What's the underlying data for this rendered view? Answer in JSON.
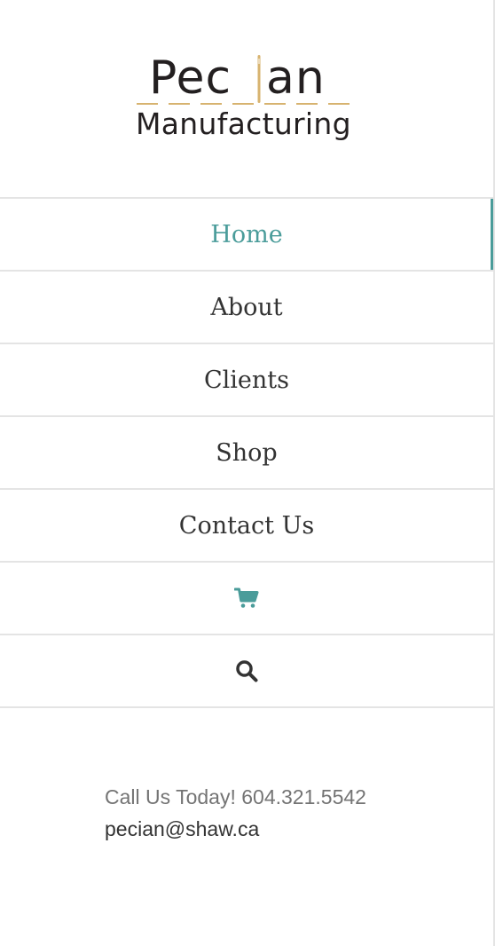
{
  "logo": {
    "name": "Pecian",
    "word_left": "Pec",
    "word_right": "an",
    "subtitle": "Manufacturing",
    "accent_color": "#d7b36f"
  },
  "nav": {
    "items": [
      {
        "label": "Home",
        "active": true
      },
      {
        "label": "About"
      },
      {
        "label": "Clients"
      },
      {
        "label": "Shop"
      },
      {
        "label": "Contact Us"
      }
    ],
    "cart_icon": "shopping-cart-icon",
    "search_icon": "search-icon",
    "accent_color": "#4a9c9a"
  },
  "contact": {
    "phone_line": "Call Us Today! 604.321.5542",
    "email": "pecian@shaw.ca"
  }
}
